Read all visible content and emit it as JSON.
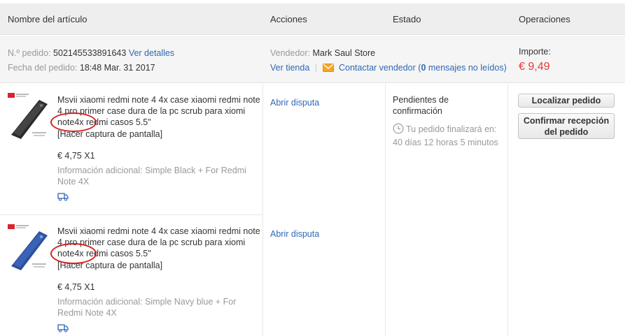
{
  "header": {
    "col_article": "Nombre del artículo",
    "col_actions": "Acciones",
    "col_status": "Estado",
    "col_operations": "Operaciones"
  },
  "order": {
    "number_label": "N.º pedido:",
    "number_value": "502145533891643",
    "details_link": "Ver detalles",
    "date_label": "Fecha del pedido:",
    "date_value": "18:48 Mar. 31 2017",
    "seller_label": "Vendedor:",
    "seller_value": "Mark Saul Store",
    "store_link": "Ver tienda",
    "separator": "|",
    "contact_link_pre": "Contactar vendedor (",
    "contact_count": "0",
    "contact_link_post": " mensajes no leídos)",
    "amount_label": "Importe:",
    "amount_value": "€ 9,49"
  },
  "items": [
    {
      "title": "Msvii xiaomi redmi note 4 4x case xiaomi redmi note 4 pro primer case dura de la pc scrub para xiomi note4x redmi casos 5.5\"",
      "screenshot_link": "[Hacer captura de pantalla]",
      "price": "€ 4,75 X1",
      "extra": "Información adicional: Simple Black + For Redmi Note 4X",
      "action": "Abrir disputa",
      "case_color": "#2b2b2b"
    },
    {
      "title": "Msvii xiaomi redmi note 4 4x case xiaomi redmi note 4 pro primer case dura de la pc scrub para xiomi note4x redmi casos 5.5\"",
      "screenshot_link": "[Hacer captura de pantalla]",
      "price": "€ 4,75 X1",
      "extra": "Información adicional: Simple Navy blue + For Redmi Note 4X",
      "action": "Abrir disputa",
      "case_color": "#2b4f9a"
    }
  ],
  "status": {
    "title": "Pendientes de confirmación",
    "countdown": "Tu pedido finalizará en: 40 días 12 horas 5 minutos"
  },
  "operations": {
    "track": "Localizar pedido",
    "confirm": "Confirmar recepción del pedido"
  },
  "colors": {
    "link": "#2e68b5",
    "price": "#e4393c",
    "annotation": "#d42020"
  }
}
